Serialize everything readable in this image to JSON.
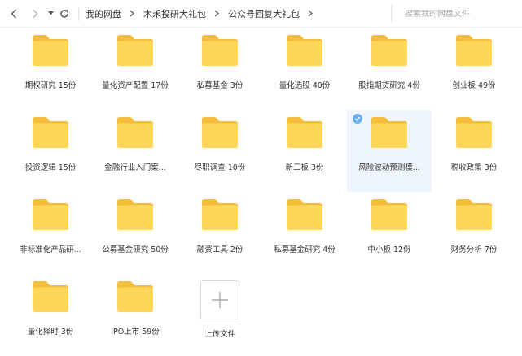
{
  "toolbar": {
    "breadcrumbs": [
      "我的网盘",
      "木禾投研大礼包",
      "公众号回复大礼包"
    ],
    "search_placeholder": "搜索我的网盘文件"
  },
  "folders": [
    {
      "label": "期权研究 15份"
    },
    {
      "label": "量化资产配置 17份"
    },
    {
      "label": "私募基金 3份"
    },
    {
      "label": "量化选股 40份"
    },
    {
      "label": "股指期货研究 4份"
    },
    {
      "label": "创业板 49份"
    },
    {
      "label": "投资逻辑 15份"
    },
    {
      "label": "金融行业入门案..."
    },
    {
      "label": "尽职调查 10份"
    },
    {
      "label": "新三板 3份"
    },
    {
      "label": "风险波动预测模...",
      "selected": true
    },
    {
      "label": "税收政策 3份"
    },
    {
      "label": "非标准化产品研..."
    },
    {
      "label": "公募基金研究 50份"
    },
    {
      "label": "融资工具 2份"
    },
    {
      "label": "私募基金研究 4份"
    },
    {
      "label": "中小板 12份"
    },
    {
      "label": "财务分析 7份"
    },
    {
      "label": "量化择时 3份"
    },
    {
      "label": "IPO上市 59份"
    }
  ],
  "upload": {
    "label": "上传文件"
  },
  "colors": {
    "folder_main": "#FFD659",
    "folder_back": "#F5BD3C",
    "selected_bg": "#EEF5FD",
    "check": "#6AB0F3"
  }
}
